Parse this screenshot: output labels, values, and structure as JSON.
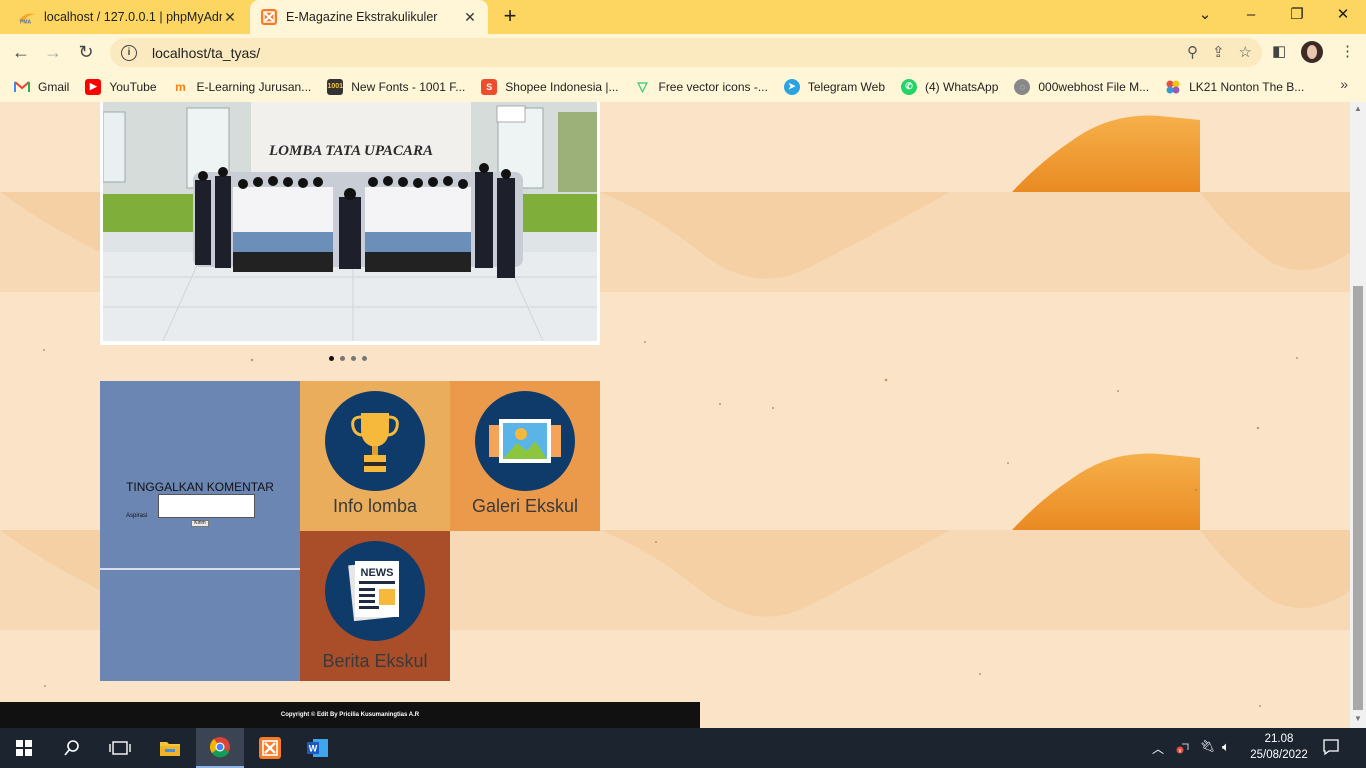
{
  "browser": {
    "tabs": [
      {
        "title": "localhost / 127.0.0.1 | phpMyAdmin",
        "favicon": "phpmyadmin-icon",
        "active": false
      },
      {
        "title": "E-Magazine Ekstrakulikuler",
        "favicon": "xampp-icon",
        "active": true
      }
    ],
    "url": "localhost/ta_tyas/",
    "bookmarks": [
      {
        "label": "Gmail",
        "icon": "gmail-icon",
        "color": "#ea4335"
      },
      {
        "label": "YouTube",
        "icon": "youtube-icon",
        "color": "#ff0000"
      },
      {
        "label": "E-Learning Jurusan...",
        "icon": "moodle-icon",
        "color": "#f98012"
      },
      {
        "label": "New Fonts - 1001 F...",
        "icon": "fonts-icon",
        "color": "#d4a017"
      },
      {
        "label": "Shopee Indonesia |...",
        "icon": "shopee-icon",
        "color": "#ee4d2d"
      },
      {
        "label": "Free vector icons -...",
        "icon": "flaticon-icon",
        "color": "#2ecc71"
      },
      {
        "label": "Telegram Web",
        "icon": "telegram-icon",
        "color": "#2aa3df"
      },
      {
        "label": "(4) WhatsApp",
        "icon": "whatsapp-icon",
        "color": "#25d366"
      },
      {
        "label": "000webhost File M...",
        "icon": "webhost-icon",
        "color": "#777777"
      },
      {
        "label": "LK21 Nonton The B...",
        "icon": "lk21-icon",
        "color": "#c0392b"
      }
    ]
  },
  "page": {
    "carousel": {
      "slide_count": 4,
      "active_slide": 0,
      "banner_text": "LOMBA TATA UPACARA"
    },
    "comment": {
      "title": "TINGGALKAN KOMENTAR",
      "field_label": "Aspirasi",
      "field_value": "",
      "submit_label": "Kirim"
    },
    "tiles": [
      {
        "label": "Info lomba",
        "icon": "trophy-icon",
        "color": "#eaad5c"
      },
      {
        "label": "Galeri Ekskul",
        "icon": "gallery-icon",
        "color": "#eb9a4b"
      },
      {
        "label": "Berita Ekskul",
        "icon": "news-icon",
        "color": "#aa4e2a"
      }
    ],
    "footer": "Copyright © Edit By Pricilia Kusumaningtias A.R"
  },
  "taskbar": {
    "time": "21.08",
    "date": "25/08/2022"
  }
}
